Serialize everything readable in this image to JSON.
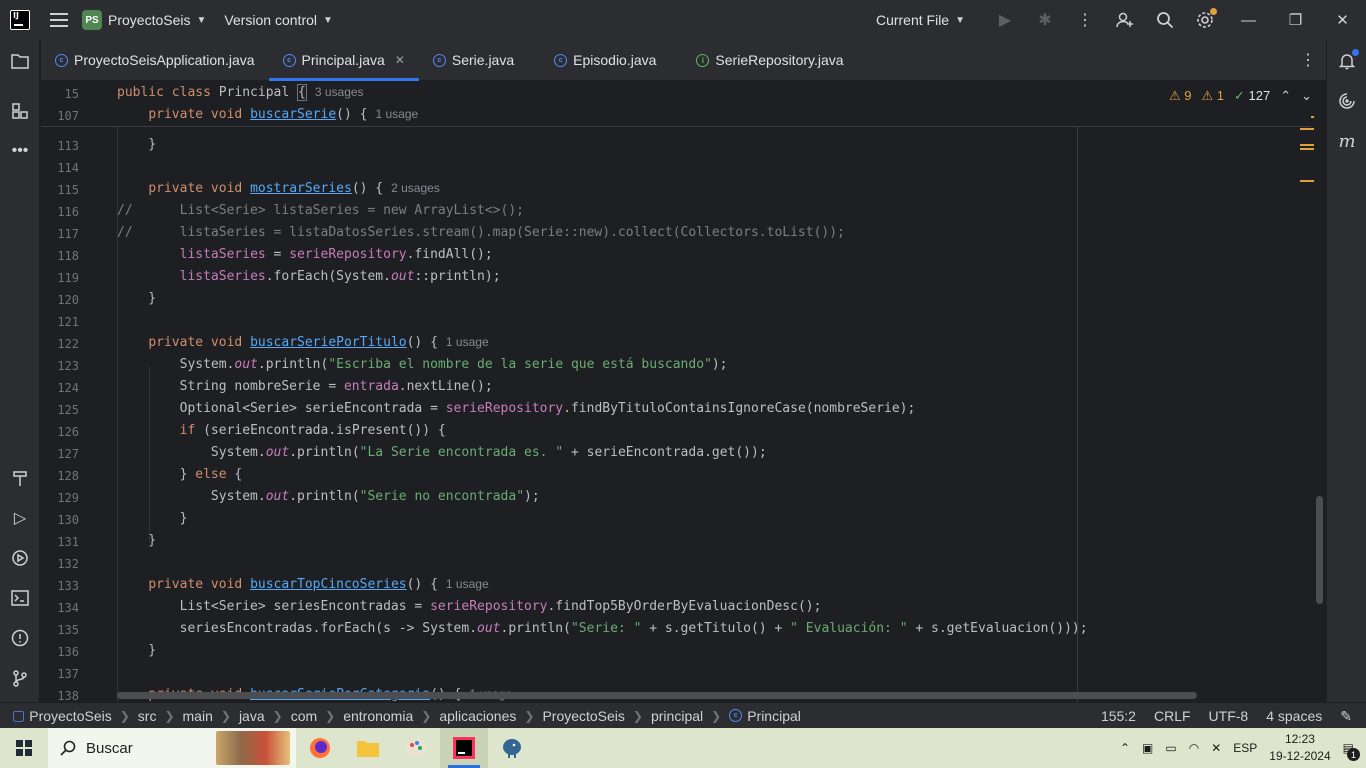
{
  "titlebar": {
    "project_badge": "PS",
    "project_name": "ProyectoSeis",
    "version_control": "Version control",
    "run_config": "Current File"
  },
  "tabs": [
    {
      "label": "ProyectoSeisApplication.java",
      "kind": "class"
    },
    {
      "label": "Principal.java",
      "kind": "class",
      "active": true
    },
    {
      "label": "Serie.java",
      "kind": "class"
    },
    {
      "label": "Episodio.java",
      "kind": "class"
    },
    {
      "label": "SerieRepository.java",
      "kind": "interface"
    }
  ],
  "inspections": {
    "warnings": "9",
    "weak_warnings": "1",
    "ok": "127"
  },
  "sticky": [
    {
      "ln": "15",
      "hint": "3 usages"
    },
    {
      "ln": "107",
      "hint": "1 usage"
    }
  ],
  "lines": [
    {
      "ln": "113"
    },
    {
      "ln": "114"
    },
    {
      "ln": "115",
      "hint": "2 usages"
    },
    {
      "ln": "116"
    },
    {
      "ln": "117"
    },
    {
      "ln": "118"
    },
    {
      "ln": "119"
    },
    {
      "ln": "120"
    },
    {
      "ln": "121"
    },
    {
      "ln": "122",
      "hint": "1 usage"
    },
    {
      "ln": "123"
    },
    {
      "ln": "124"
    },
    {
      "ln": "125"
    },
    {
      "ln": "126"
    },
    {
      "ln": "127"
    },
    {
      "ln": "128"
    },
    {
      "ln": "129"
    },
    {
      "ln": "130"
    },
    {
      "ln": "131"
    },
    {
      "ln": "132"
    },
    {
      "ln": "133",
      "hint": "1 usage"
    },
    {
      "ln": "134"
    },
    {
      "ln": "135"
    },
    {
      "ln": "136"
    },
    {
      "ln": "137"
    },
    {
      "ln": "138",
      "hint": "1 usage"
    }
  ],
  "breadcrumb": [
    "ProyectoSeis",
    "src",
    "main",
    "java",
    "com",
    "entronomia",
    "aplicaciones",
    "ProyectoSeis",
    "principal",
    "Principal"
  ],
  "status": {
    "position": "155:2",
    "line_sep": "CRLF",
    "encoding": "UTF-8",
    "indent": "4 spaces"
  },
  "taskbar": {
    "search_placeholder": "Buscar",
    "lang": "ESP",
    "time": "12:23",
    "date": "19-12-2024",
    "notif_count": "1"
  },
  "colors": {
    "accent": "#3574f0",
    "editor_bg": "#1e1f22",
    "keyword": "#cf8e6d",
    "method": "#56a8f5",
    "field": "#c77dbb",
    "string": "#6aab73",
    "warning": "#e0a040"
  }
}
